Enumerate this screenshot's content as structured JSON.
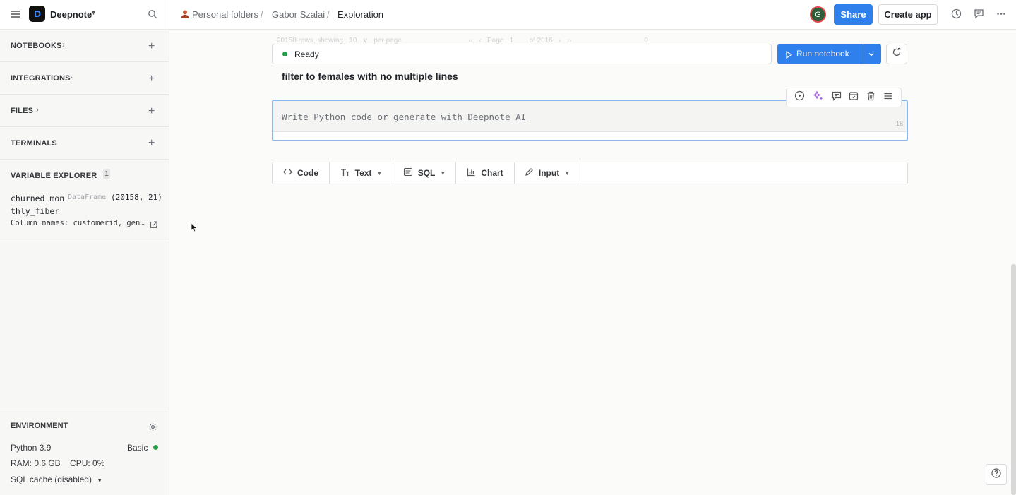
{
  "app": {
    "name": "Deepnote"
  },
  "breadcrumb": [
    "Personal folders",
    "Gabor Szalai",
    "Exploration"
  ],
  "header": {
    "avatar_initial": "G",
    "share_label": "Share",
    "create_app_label": "Create app"
  },
  "sidebar": {
    "sections": [
      "NOTEBOOKS",
      "INTEGRATIONS",
      "FILES",
      "TERMINALS"
    ],
    "variable_explorer": {
      "title": "VARIABLE EXPLORER",
      "count": "1",
      "variable": {
        "name_line1": "churned_mon",
        "name_line2": "thly_fiber",
        "type": "DataFrame",
        "shape": "(20158, 21)",
        "columns": "Column names: customerid, gen…"
      }
    },
    "environment": {
      "title": "ENVIRONMENT",
      "python": "Python 3.9",
      "machine": "Basic",
      "resources": "RAM: 0.6 GB    CPU: 0%",
      "sql_cache": "SQL cache (disabled)"
    }
  },
  "notebook": {
    "faded_pagination": "20158 rows, showing   10   ∨   per page                                  ‹‹   ‹   Page   1        of 2016   ›   ››                                     0",
    "status": "Ready",
    "run_label": "Run notebook",
    "heading": "filter to females with no multiple lines",
    "code_placeholder_prefix": "Write Python code or ",
    "code_placeholder_link": "generate with Deepnote AI",
    "line_number": "18",
    "add_blocks": [
      "Code",
      "Text",
      "SQL",
      "Chart",
      "Input"
    ]
  },
  "colors": {
    "accent": "#2f80ed",
    "ready": "#22a347",
    "ai": "#a05ad7"
  }
}
